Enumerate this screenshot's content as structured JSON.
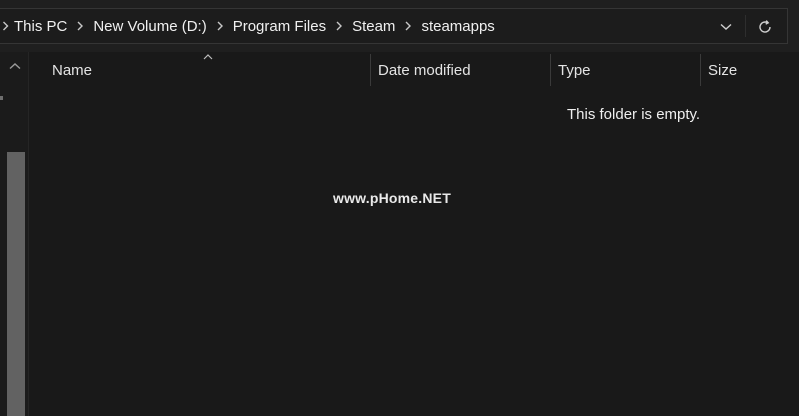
{
  "address_bar": {
    "breadcrumbs": [
      {
        "label": "This PC"
      },
      {
        "label": "New Volume (D:)"
      },
      {
        "label": "Program Files"
      },
      {
        "label": "Steam"
      },
      {
        "label": "steamapps"
      }
    ]
  },
  "file_list": {
    "columns": [
      {
        "label": "Name"
      },
      {
        "label": "Date modified"
      },
      {
        "label": "Type"
      },
      {
        "label": "Size"
      }
    ],
    "empty_message": "This folder is empty."
  },
  "watermark": {
    "text": "www.pHome.NET"
  },
  "icons": {
    "breadcrumb_separator": "chevron-right-icon",
    "address_history": "chevron-down-icon",
    "refresh": "refresh-icon",
    "sort": "chevron-up-icon",
    "nav_scroll_up": "chevron-up-icon"
  },
  "colors": {
    "background": "#191919",
    "text": "#e6e6e6",
    "scroll_thumb": "#626262"
  }
}
